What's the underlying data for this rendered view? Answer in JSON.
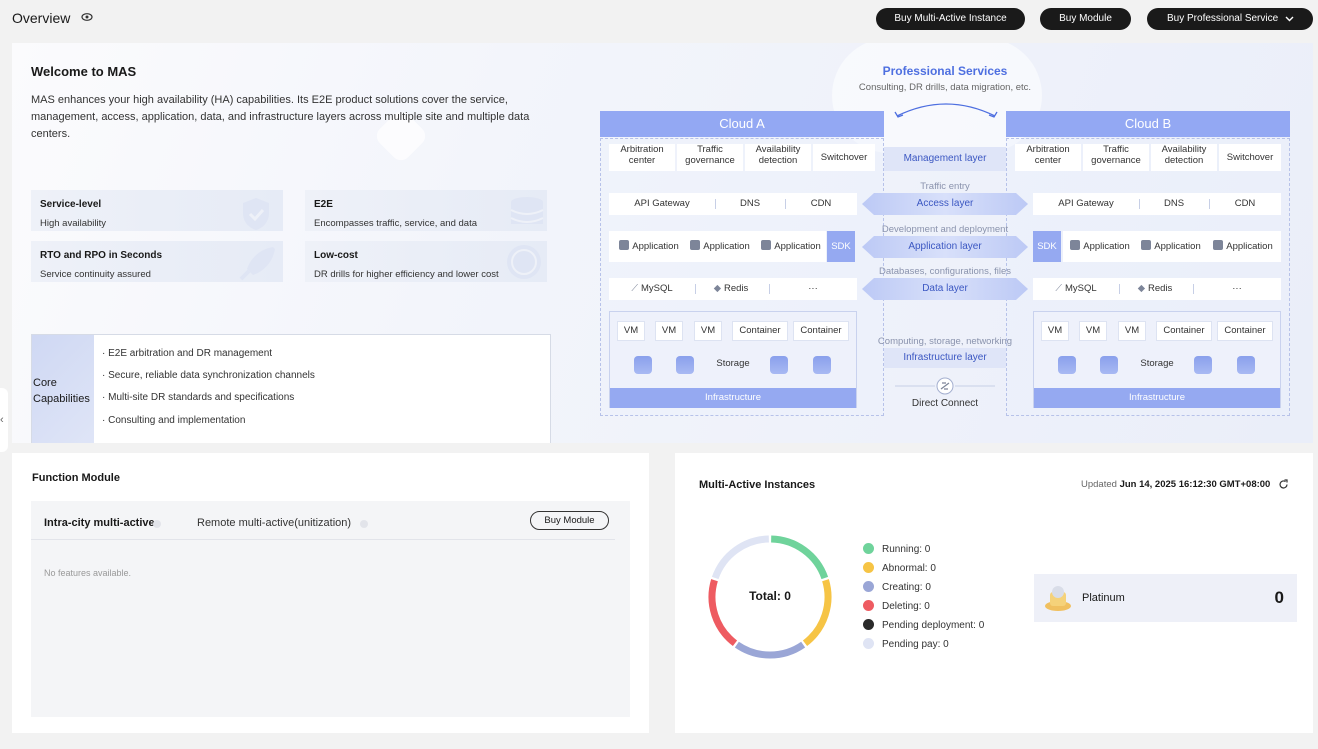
{
  "header": {
    "title": "Overview",
    "buttons": [
      "Buy Multi-Active Instance",
      "Buy Module",
      "Buy Professional Service"
    ]
  },
  "intro": {
    "title": "Welcome to MAS",
    "description": "MAS enhances your high availability (HA) capabilities. Its E2E product solutions cover the service, management, access, application, data, and infrastructure layers across multiple site and multiple data centers.",
    "features": [
      {
        "title": "Service-level",
        "desc": "High availability"
      },
      {
        "title": "E2E",
        "desc": "Encompasses traffic, service, and data"
      },
      {
        "title": "RTO and RPO in Seconds",
        "desc": "Service continuity assured"
      },
      {
        "title": "Low-cost",
        "desc": "DR drills for higher efficiency and lower cost"
      }
    ],
    "core_title": "Core Capabilities",
    "core_items": [
      "· E2E arbitration and DR management",
      "· Secure, reliable data synchronization channels",
      "· Multi-site DR standards and specifications",
      "· Consulting and implementation"
    ]
  },
  "diagram": {
    "pro_title": "Professional Services",
    "pro_sub": "Consulting, DR drills, data migration, etc.",
    "cloud_a": "Cloud A",
    "cloud_b": "Cloud B",
    "mgmt_items": [
      "Arbitration center",
      "Traffic governance",
      "Availability detection",
      "Switchover"
    ],
    "access_items": [
      "API Gateway",
      "DNS",
      "CDN"
    ],
    "app_item": "Application",
    "sdk": "SDK",
    "data_items": [
      "MySQL",
      "Redis",
      "···"
    ],
    "infra_items": [
      "VM",
      "VM",
      "VM",
      "Container",
      "Container"
    ],
    "storage": "Storage",
    "infra_bar": "Infrastructure",
    "layers": [
      {
        "caption": "",
        "label": "Management layer"
      },
      {
        "caption": "Traffic entry",
        "label": "Access layer"
      },
      {
        "caption": "Development and deployment",
        "label": "Application layer"
      },
      {
        "caption": "Databases, configurations, files",
        "label": "Data layer"
      },
      {
        "caption": "Computing, storage, networking",
        "label": "Infrastructure layer"
      }
    ],
    "direct_connect": "Direct Connect"
  },
  "function_module": {
    "title": "Function Module",
    "tabs": [
      "Intra-city multi-active",
      "Remote multi-active(unitization)"
    ],
    "buy_button": "Buy Module",
    "empty_text": "No features available."
  },
  "instances": {
    "title": "Multi-Active Instances",
    "updated_label": "Updated",
    "updated_time": "Jun 14, 2025 16:12:30 GMT+08:00",
    "total_label": "Total: 0",
    "statuses": [
      {
        "label": "Running: 0",
        "color": "#6fd39b"
      },
      {
        "label": "Abnormal: 0",
        "color": "#f6c445"
      },
      {
        "label": "Creating: 0",
        "color": "#9aa6d6"
      },
      {
        "label": "Deleting: 0",
        "color": "#ee5b61"
      },
      {
        "label": "Pending deployment: 0",
        "color": "#2a2a2a"
      },
      {
        "label": "Pending pay: 0",
        "color": "#dfe4f4"
      }
    ],
    "edition": "Platinum",
    "edition_count": "0"
  }
}
